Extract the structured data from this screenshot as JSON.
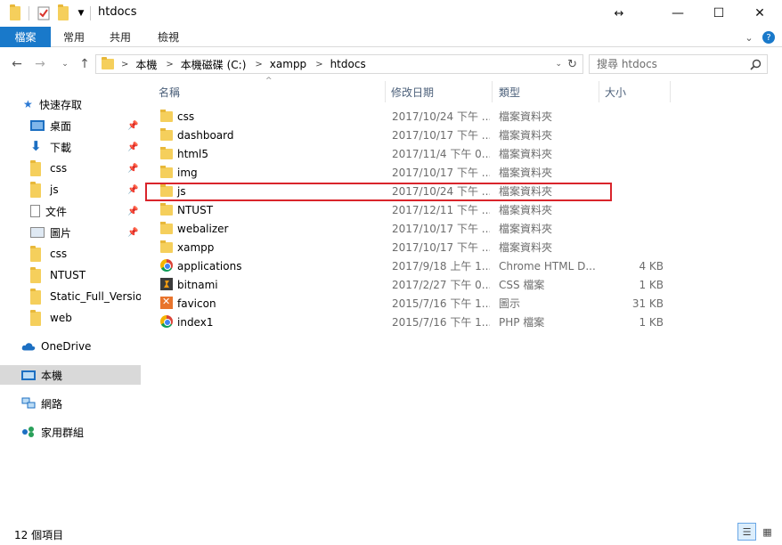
{
  "window": {
    "title": "htdocs",
    "quick_access": [
      "folder-icon",
      "properties-check-icon",
      "new-folder-icon",
      "dropdown-icon"
    ],
    "controls": {
      "resize_glyph": "↔",
      "minimize": "—",
      "maximize": "☐",
      "close": "✕"
    }
  },
  "ribbon": {
    "tabs": [
      {
        "label": "檔案",
        "active": true
      },
      {
        "label": "常用",
        "active": false
      },
      {
        "label": "共用",
        "active": false
      },
      {
        "label": "檢視",
        "active": false
      }
    ],
    "collapse_glyph": "⌄",
    "help_glyph": "?"
  },
  "address": {
    "breadcrumbs": [
      "本機",
      "本機磁碟 (C:)",
      "xampp",
      "htdocs"
    ],
    "search_placeholder": "搜尋 htdocs"
  },
  "navigation": {
    "quick_access_label": "快速存取",
    "quick_items": [
      {
        "label": "桌面",
        "icon": "desktop-icon",
        "pinned": true
      },
      {
        "label": "下載",
        "icon": "download-icon",
        "pinned": true
      },
      {
        "label": "css",
        "icon": "folder-icon",
        "pinned": true
      },
      {
        "label": "js",
        "icon": "folder-icon",
        "pinned": true
      },
      {
        "label": "文件",
        "icon": "document-icon",
        "pinned": true
      },
      {
        "label": "圖片",
        "icon": "picture-icon",
        "pinned": true
      },
      {
        "label": "css",
        "icon": "folder-icon",
        "pinned": false
      },
      {
        "label": "NTUST",
        "icon": "folder-icon",
        "pinned": false
      },
      {
        "label": "Static_Full_Version",
        "icon": "folder-icon",
        "pinned": false
      },
      {
        "label": "web",
        "icon": "folder-icon",
        "pinned": false
      }
    ],
    "onedrive": "OneDrive",
    "this_pc": "本機",
    "network": "網路",
    "homegroup": "家用群組"
  },
  "columns": {
    "name": "名稱",
    "date": "修改日期",
    "type": "類型",
    "size": "大小"
  },
  "files": [
    {
      "name": "css",
      "date": "2017/10/24 下午 ...",
      "type": "檔案資料夾",
      "size": "",
      "icon": "folder"
    },
    {
      "name": "dashboard",
      "date": "2017/10/17 下午 ...",
      "type": "檔案資料夾",
      "size": "",
      "icon": "folder"
    },
    {
      "name": "html5",
      "date": "2017/11/4 下午 0...",
      "type": "檔案資料夾",
      "size": "",
      "icon": "folder"
    },
    {
      "name": "img",
      "date": "2017/10/17 下午 ...",
      "type": "檔案資料夾",
      "size": "",
      "icon": "folder"
    },
    {
      "name": "js",
      "date": "2017/10/24 下午 ...",
      "type": "檔案資料夾",
      "size": "",
      "icon": "folder"
    },
    {
      "name": "NTUST",
      "date": "2017/12/11 下午 ...",
      "type": "檔案資料夾",
      "size": "",
      "icon": "folder"
    },
    {
      "name": "webalizer",
      "date": "2017/10/17 下午 ...",
      "type": "檔案資料夾",
      "size": "",
      "icon": "folder"
    },
    {
      "name": "xampp",
      "date": "2017/10/17 下午 ...",
      "type": "檔案資料夾",
      "size": "",
      "icon": "folder"
    },
    {
      "name": "applications",
      "date": "2017/9/18 上午 1...",
      "type": "Chrome HTML D...",
      "size": "4 KB",
      "icon": "chrome"
    },
    {
      "name": "bitnami",
      "date": "2017/2/27 下午 0...",
      "type": "CSS 檔案",
      "size": "1 KB",
      "icon": "css"
    },
    {
      "name": "favicon",
      "date": "2015/7/16 下午 1...",
      "type": "圖示",
      "size": "31 KB",
      "icon": "ico"
    },
    {
      "name": "index1",
      "date": "2015/7/16 下午 1...",
      "type": "PHP 檔案",
      "size": "1 KB",
      "icon": "chrome"
    }
  ],
  "highlighted_row": "js",
  "status": {
    "text": "12 個項目"
  },
  "colors": {
    "accent": "#1979ca",
    "highlight_border": "#d9242b",
    "folder": "#f5cf5c"
  }
}
